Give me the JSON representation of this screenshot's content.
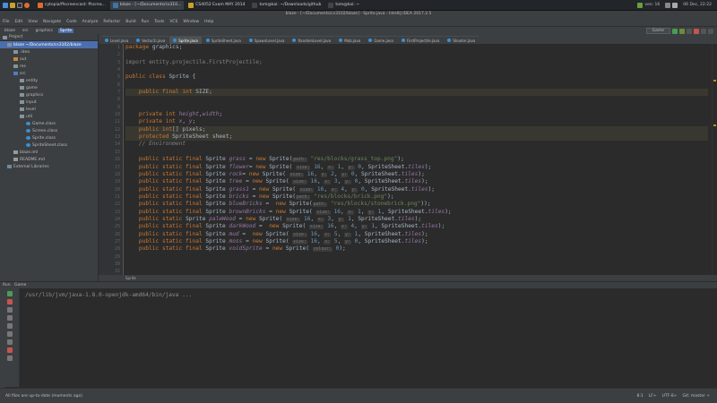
{
  "taskbar": {
    "tasks": [
      "cytopia/ffscreencast: ffscrea...",
      "blaze - [~/Documents/cs310...",
      "CS4052 Exam MAY 2014",
      "tom@kai: ~/Downloads/github",
      "tom@kai: ~"
    ],
    "clock": "06 Dec, 22:22",
    "tray_label": "ven: 16"
  },
  "window": {
    "title": "blaze - [~/Documents/cs3102/blaze] - Sprite.java - IntelliJ IDEA 2017.2.5"
  },
  "menu": [
    "File",
    "Edit",
    "View",
    "Navigate",
    "Code",
    "Analyze",
    "Refactor",
    "Build",
    "Run",
    "Tools",
    "VCS",
    "Window",
    "Help"
  ],
  "breadcrumbs": [
    "blaze",
    "src",
    "graphics",
    "Sprite"
  ],
  "run_config": "Game",
  "project_panel": {
    "title": "Project",
    "items": [
      {
        "label": "blaze ~/Documents/cs3102/blaze",
        "indent": 0,
        "kind": "folder",
        "selected": true
      },
      {
        "label": ".idea",
        "indent": 1,
        "kind": "folder"
      },
      {
        "label": "out",
        "indent": 1,
        "kind": "folder-orange"
      },
      {
        "label": "res",
        "indent": 1,
        "kind": "folder"
      },
      {
        "label": "src",
        "indent": 1,
        "kind": "folder-blue"
      },
      {
        "label": "entity",
        "indent": 2,
        "kind": "package"
      },
      {
        "label": "game",
        "indent": 2,
        "kind": "package"
      },
      {
        "label": "graphics",
        "indent": 2,
        "kind": "package"
      },
      {
        "label": "input",
        "indent": 2,
        "kind": "package"
      },
      {
        "label": "level",
        "indent": 2,
        "kind": "package"
      },
      {
        "label": "util",
        "indent": 2,
        "kind": "package"
      },
      {
        "label": "Game.class",
        "indent": 3,
        "kind": "class"
      },
      {
        "label": "Screen.class",
        "indent": 3,
        "kind": "class"
      },
      {
        "label": "Sprite.class",
        "indent": 3,
        "kind": "class"
      },
      {
        "label": "SpriteSheet.class",
        "indent": 3,
        "kind": "class"
      },
      {
        "label": "blaze.iml",
        "indent": 1,
        "kind": "file"
      },
      {
        "label": "README.md",
        "indent": 1,
        "kind": "file"
      },
      {
        "label": "External Libraries",
        "indent": 0,
        "kind": "lib"
      }
    ]
  },
  "tabs": [
    {
      "label": "Level.java",
      "active": false
    },
    {
      "label": "Vector2i.java",
      "active": false
    },
    {
      "label": "Sprite.java",
      "active": true
    },
    {
      "label": "SpriteSheet.java",
      "active": false
    },
    {
      "label": "SpawnLevel.java",
      "active": false
    },
    {
      "label": "RandomLevel.java",
      "active": false
    },
    {
      "label": "Mob.java",
      "active": false
    },
    {
      "label": "Game.java",
      "active": false
    },
    {
      "label": "FirstProjectile.java",
      "active": false
    },
    {
      "label": "Shooter.java",
      "active": false
    }
  ],
  "line_numbers": [
    "1",
    "2",
    "3",
    "4",
    "5",
    "6",
    "7",
    "8",
    "9",
    "10",
    "11",
    "12",
    "13",
    "14",
    "15",
    "16",
    "17",
    "18",
    "19",
    "20",
    "21",
    "22",
    "23",
    "24",
    "25",
    "26",
    "27",
    "28",
    "29",
    "30",
    "31"
  ],
  "code_lines": [
    [
      [
        "kw",
        "package "
      ],
      [
        "cls",
        "graphics;"
      ]
    ],
    [],
    [
      [
        "imp",
        "import entity.projectile.FirstProjectile;"
      ]
    ],
    [],
    [
      [
        "kw",
        "public class "
      ],
      [
        "cls",
        "Sprite {"
      ]
    ],
    [],
    [
      [
        "kw",
        "    public "
      ],
      [
        "kw",
        "final int "
      ],
      [
        "cls",
        "SIZE;"
      ]
    ],
    [],
    [],
    [
      [
        "kw",
        "    private int "
      ],
      [
        "fld",
        "height"
      ],
      [
        "cls",
        ","
      ],
      [
        "fld",
        "width"
      ],
      [
        "cls",
        ";"
      ]
    ],
    [
      [
        "kw",
        "    private int "
      ],
      [
        "fld",
        "x"
      ],
      [
        "cls",
        ", "
      ],
      [
        "fld",
        "y"
      ],
      [
        "cls",
        ";"
      ]
    ],
    [
      [
        "kw",
        "    public "
      ],
      [
        "kw",
        "int"
      ],
      [
        "cls",
        "[] pixels;"
      ]
    ],
    [
      [
        "kw",
        "    protected "
      ],
      [
        "cls",
        "SpriteSheet sheet;"
      ]
    ],
    [
      [
        "cmt",
        "    // Environment"
      ]
    ],
    [],
    [
      [
        "kw",
        "    public static final "
      ],
      [
        "cls",
        "Sprite "
      ],
      [
        "fld",
        "grass"
      ],
      [
        "cls",
        " = "
      ],
      [
        "kw",
        "new "
      ],
      [
        "cls",
        "Sprite("
      ],
      [
        "hint",
        "path:"
      ],
      [
        "str",
        " \"res/blocks/grass_top.png\""
      ],
      [
        "cls",
        ");"
      ]
    ],
    [
      [
        "kw",
        "    public static final "
      ],
      [
        "cls",
        "Sprite "
      ],
      [
        "fld",
        "flower"
      ],
      [
        "cls",
        "= "
      ],
      [
        "kw",
        "new "
      ],
      [
        "cls",
        "Sprite( "
      ],
      [
        "hint",
        "size:"
      ],
      [
        "num",
        " 16"
      ],
      [
        "cls",
        ", "
      ],
      [
        "hint",
        "x:"
      ],
      [
        "num",
        " 1"
      ],
      [
        "cls",
        ", "
      ],
      [
        "hint",
        "y:"
      ],
      [
        "num",
        " 0"
      ],
      [
        "cls",
        ", SpriteSheet."
      ],
      [
        "fld",
        "tiles"
      ],
      [
        "cls",
        ");"
      ]
    ],
    [
      [
        "kw",
        "    public static final "
      ],
      [
        "cls",
        "Sprite "
      ],
      [
        "fld",
        "rock"
      ],
      [
        "cls",
        "= "
      ],
      [
        "kw",
        "new "
      ],
      [
        "cls",
        "Sprite( "
      ],
      [
        "hint",
        "size:"
      ],
      [
        "num",
        " 16"
      ],
      [
        "cls",
        ", "
      ],
      [
        "hint",
        "x:"
      ],
      [
        "num",
        " 2"
      ],
      [
        "cls",
        ", "
      ],
      [
        "hint",
        "y:"
      ],
      [
        "num",
        " 0"
      ],
      [
        "cls",
        ", SpriteSheet."
      ],
      [
        "fld",
        "tiles"
      ],
      [
        "cls",
        ");"
      ]
    ],
    [
      [
        "kw",
        "    public static final "
      ],
      [
        "cls",
        "Sprite "
      ],
      [
        "fld",
        "tree"
      ],
      [
        "cls",
        " = "
      ],
      [
        "kw",
        "new "
      ],
      [
        "cls",
        "Sprite( "
      ],
      [
        "hint",
        "size:"
      ],
      [
        "num",
        " 16"
      ],
      [
        "cls",
        ", "
      ],
      [
        "hint",
        "x:"
      ],
      [
        "num",
        " 3"
      ],
      [
        "cls",
        ", "
      ],
      [
        "hint",
        "y:"
      ],
      [
        "num",
        " 0"
      ],
      [
        "cls",
        ", SpriteSheet."
      ],
      [
        "fld",
        "tiles"
      ],
      [
        "cls",
        ");"
      ]
    ],
    [
      [
        "kw",
        "    public static final "
      ],
      [
        "cls",
        "Sprite "
      ],
      [
        "fld",
        "grass1"
      ],
      [
        "cls",
        " = "
      ],
      [
        "kw",
        "new "
      ],
      [
        "cls",
        "Sprite( "
      ],
      [
        "hint",
        "size:"
      ],
      [
        "num",
        " 16"
      ],
      [
        "cls",
        ", "
      ],
      [
        "hint",
        "x:"
      ],
      [
        "num",
        " 4"
      ],
      [
        "cls",
        ", "
      ],
      [
        "hint",
        "y:"
      ],
      [
        "num",
        " 0"
      ],
      [
        "cls",
        ", SpriteSheet."
      ],
      [
        "fld",
        "tiles"
      ],
      [
        "cls",
        ");"
      ]
    ],
    [
      [
        "kw",
        "    public static final "
      ],
      [
        "cls",
        "Sprite "
      ],
      [
        "fld",
        "bricks"
      ],
      [
        "cls",
        " = "
      ],
      [
        "kw",
        "new "
      ],
      [
        "cls",
        "Sprite("
      ],
      [
        "hint",
        "path:"
      ],
      [
        "str",
        " \"res/blocks/brick.png\""
      ],
      [
        "cls",
        ");"
      ]
    ],
    [
      [
        "kw",
        "    public static final "
      ],
      [
        "cls",
        "Sprite "
      ],
      [
        "fld",
        "blueBricks"
      ],
      [
        "cls",
        " =  "
      ],
      [
        "kw",
        "new "
      ],
      [
        "cls",
        "Sprite("
      ],
      [
        "hint",
        "path:"
      ],
      [
        "str",
        " \"res/blocks/stonebrick.png\""
      ],
      [
        "cls",
        "));"
      ]
    ],
    [
      [
        "kw",
        "    public static final "
      ],
      [
        "cls",
        "Sprite "
      ],
      [
        "fld",
        "brownBricks"
      ],
      [
        "cls",
        " = "
      ],
      [
        "kw",
        "new "
      ],
      [
        "cls",
        "Sprite( "
      ],
      [
        "hint",
        "size:"
      ],
      [
        "num",
        " 16"
      ],
      [
        "cls",
        ", "
      ],
      [
        "hint",
        "x:"
      ],
      [
        "num",
        " 1"
      ],
      [
        "cls",
        ", "
      ],
      [
        "hint",
        "y:"
      ],
      [
        "num",
        " 1"
      ],
      [
        "cls",
        ", SpriteSheet."
      ],
      [
        "fld",
        "tiles"
      ],
      [
        "cls",
        ");"
      ]
    ],
    [
      [
        "kw",
        "    public static "
      ],
      [
        "cls",
        "Sprite "
      ],
      [
        "fld",
        "paleWood"
      ],
      [
        "cls",
        " = "
      ],
      [
        "kw",
        "new "
      ],
      [
        "cls",
        "Sprite( "
      ],
      [
        "hint",
        "size:"
      ],
      [
        "num",
        " 16"
      ],
      [
        "cls",
        ", "
      ],
      [
        "hint",
        "x:"
      ],
      [
        "num",
        " 3"
      ],
      [
        "cls",
        ", "
      ],
      [
        "hint",
        "y:"
      ],
      [
        "num",
        " 1"
      ],
      [
        "cls",
        ", SpriteSheet."
      ],
      [
        "fld",
        "tiles"
      ],
      [
        "cls",
        ");"
      ]
    ],
    [
      [
        "kw",
        "    public static final "
      ],
      [
        "cls",
        "Sprite "
      ],
      [
        "fld",
        "darkWood"
      ],
      [
        "cls",
        " =  "
      ],
      [
        "kw",
        "new "
      ],
      [
        "cls",
        "Sprite( "
      ],
      [
        "hint",
        "size:"
      ],
      [
        "num",
        " 16"
      ],
      [
        "cls",
        ", "
      ],
      [
        "hint",
        "x:"
      ],
      [
        "num",
        " 4"
      ],
      [
        "cls",
        ", "
      ],
      [
        "hint",
        "y:"
      ],
      [
        "num",
        " 1"
      ],
      [
        "cls",
        ", SpriteSheet."
      ],
      [
        "fld",
        "tiles"
      ],
      [
        "cls",
        ");"
      ]
    ],
    [
      [
        "kw",
        "    public static final "
      ],
      [
        "cls",
        "Sprite "
      ],
      [
        "fld",
        "mud"
      ],
      [
        "cls",
        " =  "
      ],
      [
        "kw",
        "new "
      ],
      [
        "cls",
        "Sprite( "
      ],
      [
        "hint",
        "size:"
      ],
      [
        "num",
        " 16"
      ],
      [
        "cls",
        ", "
      ],
      [
        "hint",
        "x:"
      ],
      [
        "num",
        " 5"
      ],
      [
        "cls",
        ", "
      ],
      [
        "hint",
        "y:"
      ],
      [
        "num",
        " 1"
      ],
      [
        "cls",
        ", SpriteSheet."
      ],
      [
        "fld",
        "tiles"
      ],
      [
        "cls",
        ");"
      ]
    ],
    [
      [
        "kw",
        "    public static final "
      ],
      [
        "cls",
        "Sprite "
      ],
      [
        "fld",
        "moss"
      ],
      [
        "cls",
        " = "
      ],
      [
        "kw",
        "new "
      ],
      [
        "cls",
        "Sprite( "
      ],
      [
        "hint",
        "size:"
      ],
      [
        "num",
        " 16"
      ],
      [
        "cls",
        ", "
      ],
      [
        "hint",
        "x:"
      ],
      [
        "num",
        " 5"
      ],
      [
        "cls",
        ", "
      ],
      [
        "hint",
        "y:"
      ],
      [
        "num",
        " 0"
      ],
      [
        "cls",
        ", SpriteSheet."
      ],
      [
        "fld",
        "tiles"
      ],
      [
        "cls",
        ");"
      ]
    ],
    [
      [
        "kw",
        "    public static final "
      ],
      [
        "cls",
        "Sprite "
      ],
      [
        "fld",
        "voidSprite"
      ],
      [
        "cls",
        " = "
      ],
      [
        "kw",
        "new "
      ],
      [
        "cls",
        "Sprite( "
      ],
      [
        "hint",
        "colour:"
      ],
      [
        "num",
        " 0"
      ],
      [
        "cls",
        ");"
      ]
    ]
  ],
  "editor_breadcrumb": "Sprite",
  "run_panel": {
    "label": "Run",
    "config": "Game"
  },
  "console_text": "/usr/lib/jvm/java-1.8.0-openjdk-amd64/bin/java ...",
  "status": {
    "left": "All files are up-to-date (moments ago)",
    "position": "8:1",
    "line_sep": "LF÷",
    "encoding": "UTF-8÷",
    "vcs": "Git: master ÷"
  }
}
